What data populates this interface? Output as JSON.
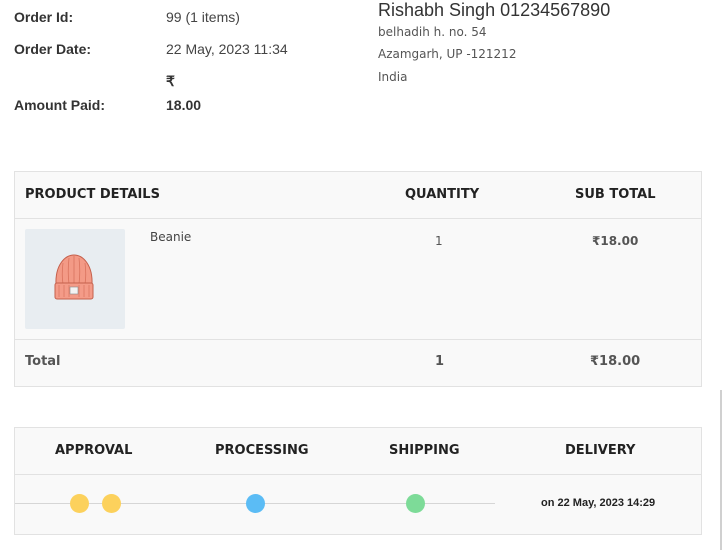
{
  "order": {
    "id_label": "Order Id:",
    "id_value": "99 (1 items)",
    "date_label": "Order Date:",
    "date_value": "22 May, 2023 11:34",
    "amount_label": "Amount Paid:",
    "currency_symbol": "₹",
    "amount_value": "18.00"
  },
  "address": {
    "name_phone": "Rishabh Singh 01234567890",
    "line1": "belhadih h. no. 54",
    "line2": "Azamgarh, UP -121212",
    "country": "India"
  },
  "products_table": {
    "headers": {
      "product": "PRODUCT DETAILS",
      "quantity": "QUANTITY",
      "subtotal": "SUB TOTAL"
    },
    "items": [
      {
        "name": "Beanie",
        "quantity": "1",
        "subtotal": "₹18.00",
        "image_icon": "beanie-icon"
      }
    ],
    "total": {
      "label": "Total",
      "quantity": "1",
      "subtotal": "₹18.00"
    }
  },
  "tracking": {
    "stages": [
      "APPROVAL",
      "PROCESSING",
      "SHIPPING",
      "DELIVERY"
    ],
    "delivery_date": "on 22 May, 2023 14:29",
    "colors": {
      "approval": "#fcd15c",
      "processing": "#5bbcf5",
      "shipping": "#7ddb98"
    }
  }
}
